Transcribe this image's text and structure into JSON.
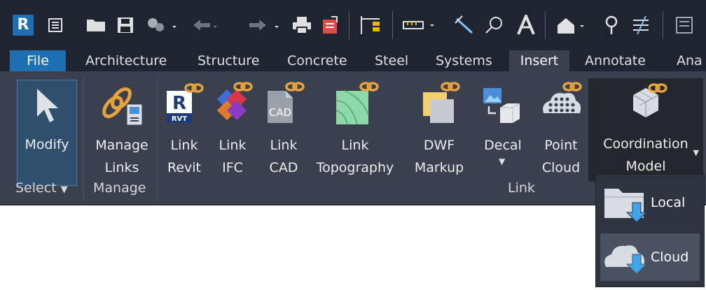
{
  "tabs": [
    {
      "label": "File"
    },
    {
      "label": "Architecture"
    },
    {
      "label": "Structure"
    },
    {
      "label": "Concrete"
    },
    {
      "label": "Steel"
    },
    {
      "label": "Systems"
    },
    {
      "label": "Insert"
    },
    {
      "label": "Annotate"
    },
    {
      "label": "Ana"
    }
  ],
  "active_tab": "Insert",
  "app_icon_letter": "R",
  "panels": {
    "select": {
      "label": "Select"
    },
    "manage": {
      "label": "Manage"
    },
    "link": {
      "label": "Link"
    }
  },
  "tools": {
    "modify": {
      "l1": "Modify",
      "l2": ""
    },
    "manage_links": {
      "l1": "Manage",
      "l2": "Links"
    },
    "link_revit": {
      "l1": "Link",
      "l2": "Revit"
    },
    "link_ifc": {
      "l1": "Link",
      "l2": "IFC"
    },
    "link_cad": {
      "l1": "Link",
      "l2": "CAD"
    },
    "link_topo": {
      "l1": "Link",
      "l2": "Topography"
    },
    "dwf": {
      "l1": "DWF",
      "l2": "Markup"
    },
    "decal": {
      "l1": "Decal",
      "l2": ""
    },
    "point_cloud": {
      "l1": "Point",
      "l2": "Cloud"
    },
    "coord": {
      "l1": "Coordination",
      "l2": "Model"
    }
  },
  "icon_text": {
    "revit": "R",
    "rvt": "RVT",
    "cad": "CAD"
  },
  "dropdown": {
    "items": [
      {
        "label": "Local"
      },
      {
        "label": "Cloud"
      }
    ]
  },
  "colors": {
    "accent": "#1f6fb3",
    "ribbon": "#3a404d",
    "titlebar": "#1e2430",
    "link_chain": "#e6a23c"
  }
}
